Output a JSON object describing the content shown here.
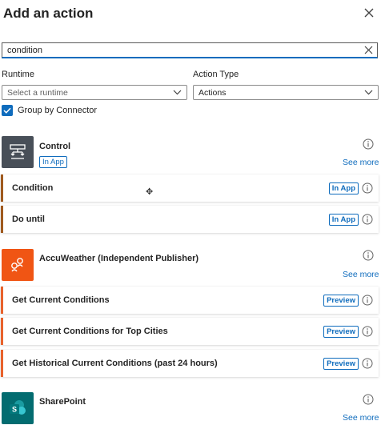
{
  "panel": {
    "title": "Add an action"
  },
  "search": {
    "value": "condition"
  },
  "filters": {
    "runtime_label": "Runtime",
    "runtime_placeholder": "Select a runtime",
    "action_type_label": "Action Type",
    "action_type_value": "Actions"
  },
  "group_by": {
    "label": "Group by Connector",
    "checked": true
  },
  "connectors": [
    {
      "name": "Control",
      "badge": "In App",
      "see_more": "See more",
      "icon": "control-flow-icon",
      "color": "#484f58",
      "actions": [
        {
          "label": "Condition",
          "badge": "In App"
        },
        {
          "label": "Do until",
          "badge": "In App"
        }
      ]
    },
    {
      "name": "AccuWeather (Independent Publisher)",
      "see_more": "See more",
      "icon": "accuweather-icon",
      "color": "#f05514",
      "actions": [
        {
          "label": "Get Current Conditions",
          "badge": "Preview"
        },
        {
          "label": "Get Current Conditions for Top Cities",
          "badge": "Preview"
        },
        {
          "label": "Get Historical Current Conditions (past 24 hours)",
          "badge": "Preview"
        }
      ]
    },
    {
      "name": "SharePoint",
      "see_more": "See more",
      "icon": "sharepoint-icon",
      "color": "#036c70"
    }
  ],
  "colors": {
    "accent": "#0f6cbd",
    "control_row_border": "#a05a1e",
    "accuweather_row_border": "#e8622c"
  }
}
